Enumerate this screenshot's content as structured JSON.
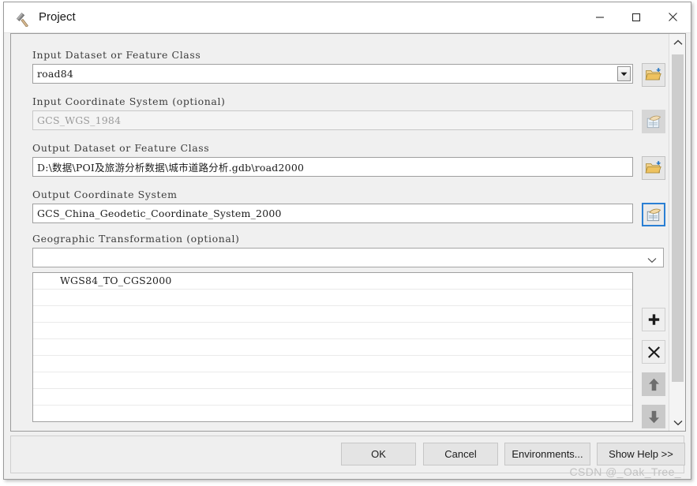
{
  "window": {
    "title": "Project",
    "icon": "hammer-icon",
    "controls": {
      "minimize": "minimize-icon",
      "maximize": "maximize-icon",
      "close": "close-icon"
    }
  },
  "form": {
    "input_dataset": {
      "label": "Input Dataset or Feature Class",
      "value": "road84",
      "dropdown_icon": "chevron-down-icon",
      "browse_icon": "open-folder-icon"
    },
    "input_coordinate_system": {
      "label": "Input Coordinate System (optional)",
      "value": "GCS_WGS_1984",
      "disabled": true,
      "browse_icon": "spatial-reference-icon"
    },
    "output_dataset": {
      "label": "Output Dataset or Feature Class",
      "value": "D:\\数据\\POI及旅游分析数据\\城市道路分析.gdb\\road2000",
      "browse_icon": "open-folder-icon"
    },
    "output_coordinate_system": {
      "label": "Output Coordinate System",
      "value": "GCS_China_Geodetic_Coordinate_System_2000",
      "browse_icon": "spatial-reference-icon",
      "focused": true
    },
    "geographic_transformation": {
      "label": "Geographic Transformation (optional)",
      "value": "",
      "placeholder": "",
      "dropdown_icon": "chevron-down-icon"
    }
  },
  "transformation_list": {
    "items": [
      "WGS84_TO_CGS2000"
    ],
    "empty_row_count": 8,
    "actions": [
      {
        "name": "add-button",
        "icon": "plus-icon",
        "enabled": true
      },
      {
        "name": "remove-button",
        "icon": "x-icon",
        "enabled": true
      },
      {
        "name": "move-up-button",
        "icon": "arrow-up-icon",
        "enabled": false
      },
      {
        "name": "move-down-button",
        "icon": "arrow-down-icon",
        "enabled": false
      }
    ]
  },
  "scrollbar": {
    "up_icon": "chevron-up-icon",
    "down_icon": "chevron-down-icon"
  },
  "footer": {
    "buttons": [
      {
        "name": "ok-button",
        "label": "OK"
      },
      {
        "name": "cancel-button",
        "label": "Cancel"
      },
      {
        "name": "environments-button",
        "label": "Environments..."
      },
      {
        "name": "show-help-button",
        "label": "Show Help >>"
      }
    ]
  },
  "watermark": "CSDN @_Oak_Tree_",
  "colors": {
    "dialog_background": "#f0f0f0",
    "titlebar_background": "#ffffff",
    "focus_border": "#2a7fd4",
    "folder_icon": "#e8c466",
    "text": "#1b1b1b",
    "disabled_text": "#9a9a9a",
    "watermark": "#c2c2c2"
  }
}
